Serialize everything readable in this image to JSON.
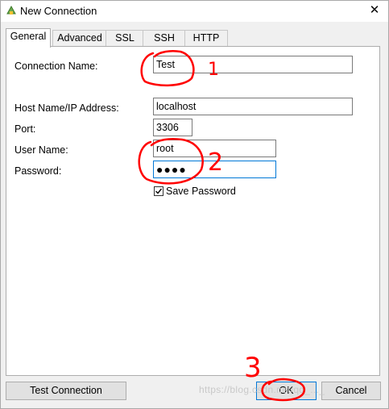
{
  "window": {
    "title": "New Connection",
    "close_glyph": "✕"
  },
  "tabs": [
    {
      "label": "General",
      "active": true
    },
    {
      "label": "Advanced"
    },
    {
      "label": "SSL"
    },
    {
      "label": "SSH"
    },
    {
      "label": "HTTP"
    }
  ],
  "form": {
    "connection_name_label": "Connection Name:",
    "connection_name_value": "Test",
    "host_label": "Host Name/IP Address:",
    "host_value": "localhost",
    "port_label": "Port:",
    "port_value": "3306",
    "user_label": "User Name:",
    "user_value": "root",
    "password_label": "Password:",
    "password_value": "●●●●",
    "save_password_label": "Save Password",
    "save_password_checked": true
  },
  "buttons": {
    "test_connection": "Test Connection",
    "ok": "OK",
    "cancel": "Cancel"
  },
  "annotations": {
    "mark_1": "1",
    "mark_2": "2",
    "mark_3": "3",
    "color": "#ff0000"
  },
  "watermark": "https://blog.csdn.net/qq_..._"
}
